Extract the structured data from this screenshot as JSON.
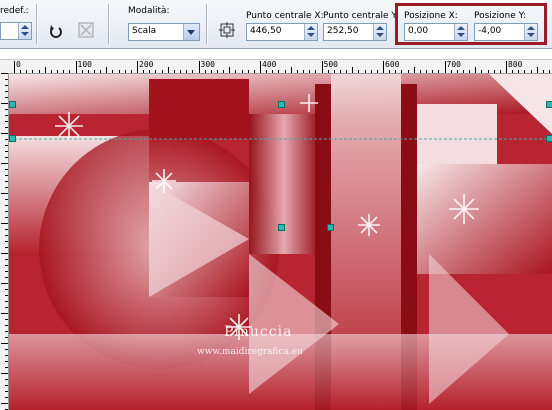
{
  "toolbar": {
    "preset_label": "redef.:",
    "mode_label": "Modalità:",
    "mode_value": "Scala",
    "center_x_label": "Punto centrale X:",
    "center_x_value": "446,50",
    "center_y_label": "Punto centrale Y:",
    "center_y_value": "252,50",
    "pos_x_label": "Posizione X:",
    "pos_x_value": "0,00",
    "pos_y_label": "Posizione Y:",
    "pos_y_value": "-4,00",
    "highlight_color": "#9b1b22"
  },
  "ruler": {
    "labels": [
      "0",
      "100",
      "200",
      "300",
      "400",
      "500",
      "600",
      "700",
      "800"
    ]
  },
  "canvas": {
    "watermark_title": "Pinuccia",
    "watermark_url": "www.maidiregrafica.eu",
    "colors": {
      "dark_red": "#a4121d",
      "mid_red": "#c23a45",
      "pale": "#f2d6d9"
    }
  },
  "icons": [
    "reset-icon",
    "clear-icon",
    "center-icon",
    "dropdown-icon"
  ]
}
